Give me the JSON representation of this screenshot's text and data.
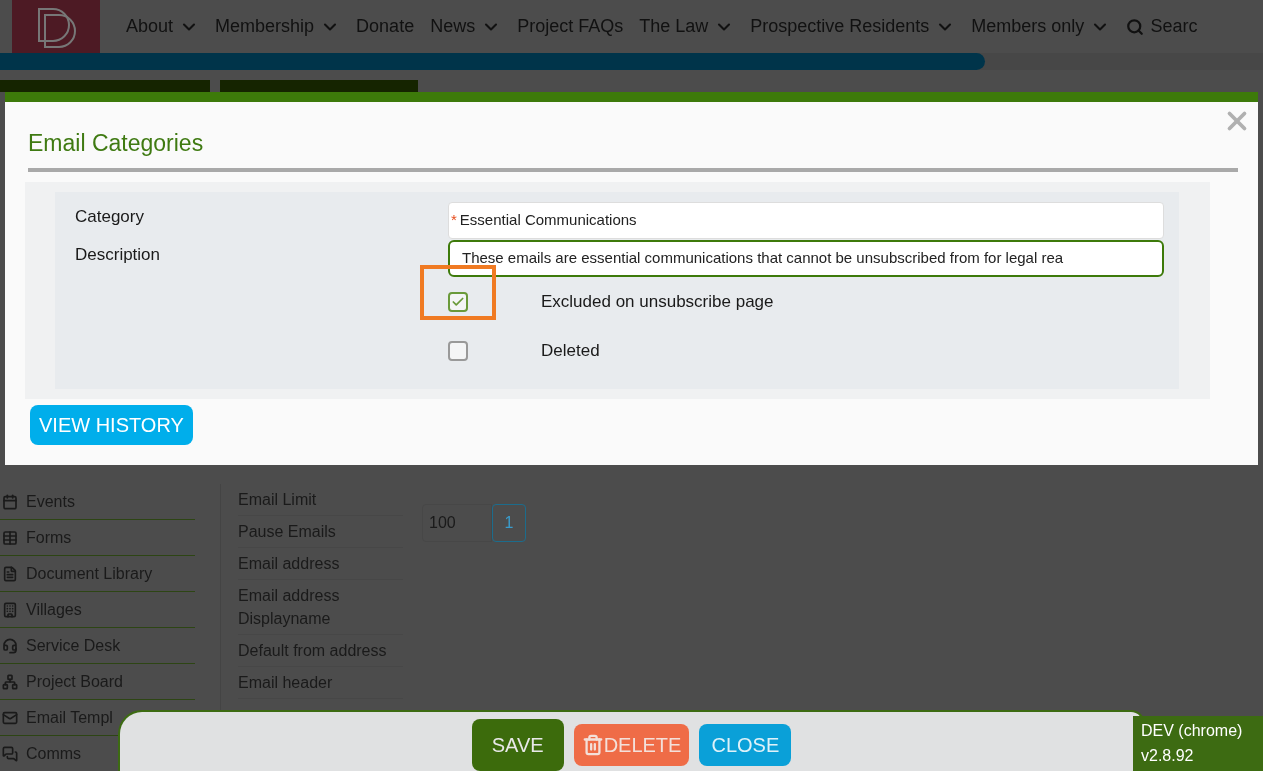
{
  "nav": [
    {
      "label": "About",
      "dropdown": true
    },
    {
      "label": "Membership",
      "dropdown": true
    },
    {
      "label": "Donate",
      "dropdown": false
    },
    {
      "label": "News",
      "dropdown": true
    },
    {
      "label": "Project FAQs",
      "dropdown": false
    },
    {
      "label": "The Law",
      "dropdown": true
    },
    {
      "label": "Prospective Residents",
      "dropdown": true
    },
    {
      "label": "Members only",
      "dropdown": true
    },
    {
      "label": "Searc",
      "dropdown": false,
      "kind": "search"
    }
  ],
  "progress": {
    "level": 0.78
  },
  "sidebar": {
    "items": [
      {
        "label": "Events"
      },
      {
        "label": "Forms"
      },
      {
        "label": "Document Library"
      },
      {
        "label": "Villages"
      },
      {
        "label": "Service Desk"
      },
      {
        "label": "Project Board"
      },
      {
        "label": "Email Templ"
      },
      {
        "label": "Comms"
      }
    ]
  },
  "settings_menu": {
    "items": [
      "Email Limit",
      "Pause Emails",
      "Email address",
      "Email address Displayname",
      "Default from address",
      "Email header"
    ]
  },
  "pagination": {
    "page_size": "100",
    "pages": [
      {
        "label": "1",
        "selected": true
      }
    ]
  },
  "modal": {
    "title": "Email Categories",
    "required_mark": "*",
    "fields": [
      {
        "label": "Category",
        "value": "Essential Communications",
        "required": true,
        "focused": false
      },
      {
        "label": "Description",
        "value": "These emails are essential communications that cannot be unsubscribed from for legal rea",
        "required": false,
        "focused": true
      }
    ],
    "checkboxes": [
      {
        "label": "Excluded on unsubscribe page",
        "checked": true,
        "highlighted": true
      },
      {
        "label": "Deleted",
        "checked": false,
        "highlighted": false
      }
    ],
    "history_button": "VIEW HISTORY"
  },
  "footer": {
    "buttons": [
      {
        "label": "SAVE",
        "kind": "save"
      },
      {
        "label": "DELETE",
        "kind": "delete"
      },
      {
        "label": "CLOSE",
        "kind": "close"
      }
    ]
  },
  "env_badge": {
    "lines": [
      "DEV (chrome)",
      "v2.8.92"
    ]
  }
}
